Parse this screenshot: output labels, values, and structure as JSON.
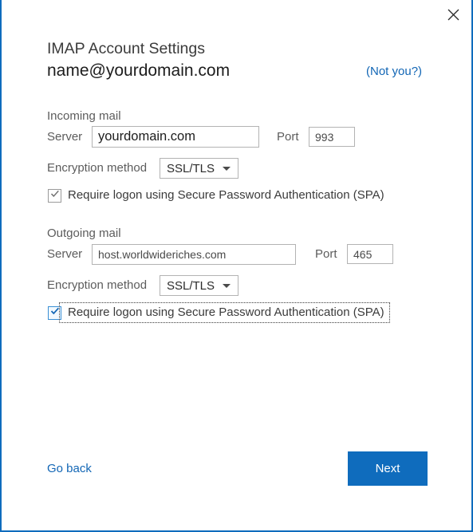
{
  "window": {
    "border_color": "#0f6cbd",
    "close_icon": "close-icon"
  },
  "header": {
    "title": "IMAP Account Settings",
    "account_email": "name@yourdomain.com",
    "not_you_link": "(Not you?)"
  },
  "incoming": {
    "section_label": "Incoming mail",
    "server_label": "Server",
    "server_value": "yourdomain.com",
    "port_label": "Port",
    "port_value": "993",
    "encryption_label": "Encryption method",
    "encryption_value": "SSL/TLS",
    "encryption_arrow_icon": "chevron-down-icon",
    "spa_label": "Require logon using Secure Password Authentication (SPA)",
    "spa_checked": "checked",
    "spa_check_icon": "check-icon"
  },
  "outgoing": {
    "section_label": "Outgoing mail",
    "server_label": "Server",
    "server_value": "host.worldwideriches.com",
    "port_label": "Port",
    "port_value": "465",
    "encryption_label": "Encryption method",
    "encryption_value": "SSL/TLS",
    "encryption_arrow_icon": "chevron-down-icon",
    "spa_label": "Require logon using Secure Password Authentication (SPA)",
    "spa_checked": "checked",
    "spa_focused": "focused",
    "spa_check_icon": "check-icon"
  },
  "footer": {
    "go_back_label": "Go back",
    "next_label": "Next",
    "accent_color": "#0f6cbd",
    "link_color": "#1266b5"
  }
}
